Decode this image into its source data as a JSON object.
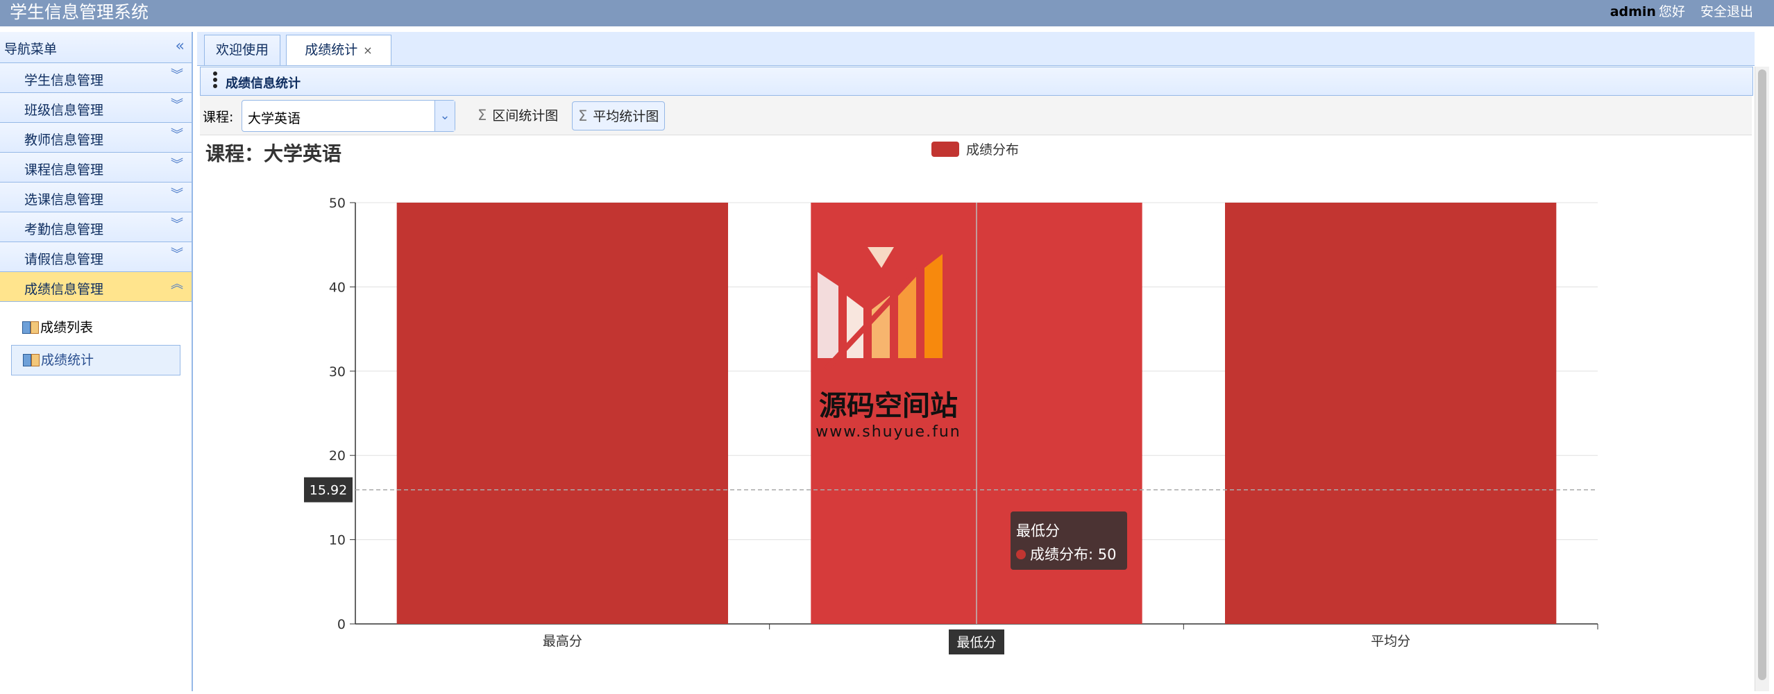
{
  "app": {
    "title": "学生信息管理系统"
  },
  "header": {
    "user": "admin",
    "greeting": "您好",
    "logout": "安全退出"
  },
  "sidebar": {
    "title": "导航菜单",
    "items": [
      {
        "label": "学生信息管理"
      },
      {
        "label": "班级信息管理"
      },
      {
        "label": "教师信息管理"
      },
      {
        "label": "课程信息管理"
      },
      {
        "label": "选课信息管理"
      },
      {
        "label": "考勤信息管理"
      },
      {
        "label": "请假信息管理"
      },
      {
        "label": "成绩信息管理"
      }
    ],
    "subitems": [
      {
        "label": "成绩列表"
      },
      {
        "label": "成绩统计"
      }
    ]
  },
  "tabs": [
    {
      "label": "欢迎使用"
    },
    {
      "label": "成绩统计",
      "close": "×"
    }
  ],
  "panel": {
    "title": "成绩信息统计"
  },
  "toolbar": {
    "course_label": "课程:",
    "course_value": "大学英语",
    "btn_interval": "区间统计图",
    "btn_average": "平均统计图"
  },
  "chart_data": {
    "type": "bar",
    "title": "课程：大学英语",
    "categories": [
      "最高分",
      "最低分",
      "平均分"
    ],
    "series": [
      {
        "name": "成绩分布",
        "values": [
          50,
          50,
          50
        ]
      }
    ],
    "ylim": [
      0,
      50
    ],
    "yticks": [
      "0",
      "10",
      "20",
      "30",
      "40",
      "50"
    ],
    "legend_position": "top",
    "grid": true,
    "color": "#c23531",
    "highlight_color": "#d63b3b",
    "pointer_value": "15.92",
    "pointer_category": "最低分"
  },
  "tooltip": {
    "title": "最低分",
    "text": "成绩分布: 50"
  },
  "watermark": {
    "text": "源码空间站",
    "url": "www.shuyue.fun"
  }
}
